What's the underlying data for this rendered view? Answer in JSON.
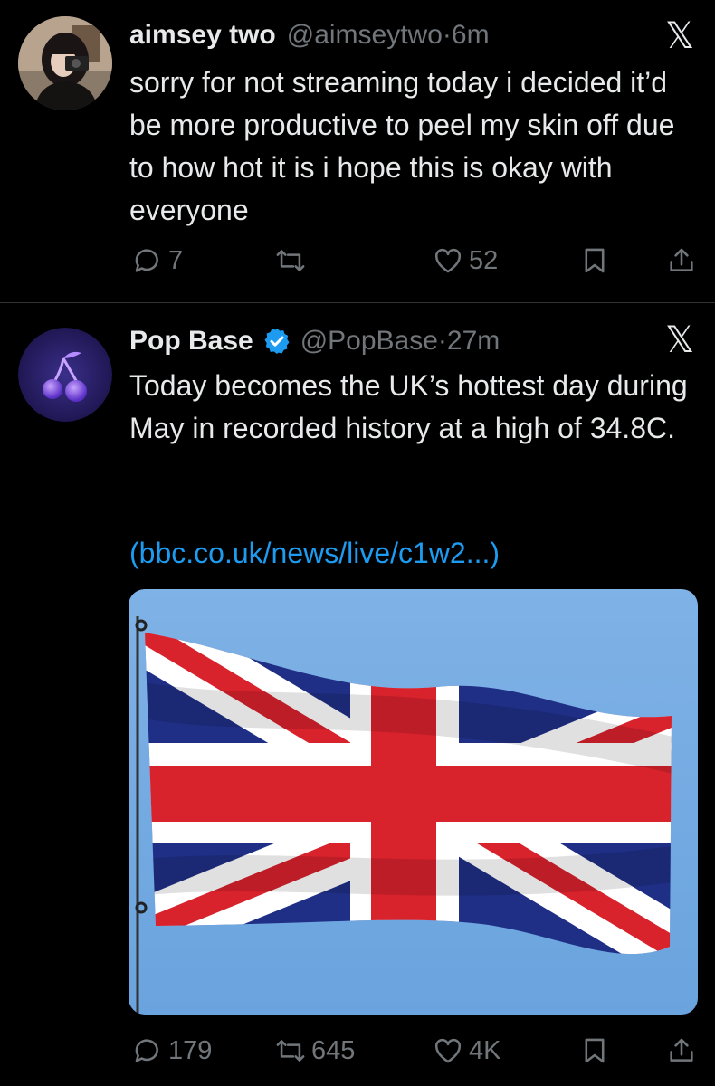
{
  "tweets": [
    {
      "display_name": "aimsey two",
      "handle_time": "@aimseytwo·6m",
      "text": "sorry for not streaming today i decided it’d be more productive to peel my skin off due to how hot it is i hope this is okay with everyone",
      "actions": {
        "replies": "7",
        "retweets": "",
        "likes": "52"
      }
    },
    {
      "display_name": "Pop Base",
      "verified": true,
      "handle_time": "@PopBase·27m",
      "text": "Today becomes the UK’s hottest day during May in recorded history at a high of 34.8C.",
      "link_text": "(bbc.co.uk/news/live/c1w2...)",
      "actions": {
        "replies": "179",
        "retweets": "645",
        "likes": "4K"
      }
    }
  ],
  "x_logo": "𝕏",
  "colors": {
    "link": "#1d9bf0",
    "muted": "#71767b",
    "text": "#e7e9ea",
    "verified": "#1d9bf0"
  },
  "icons": [
    "reply-icon",
    "retweet-icon",
    "like-icon",
    "bookmark-icon",
    "share-icon",
    "verified-badge-icon",
    "x-logo-icon",
    "cherry-icon"
  ]
}
